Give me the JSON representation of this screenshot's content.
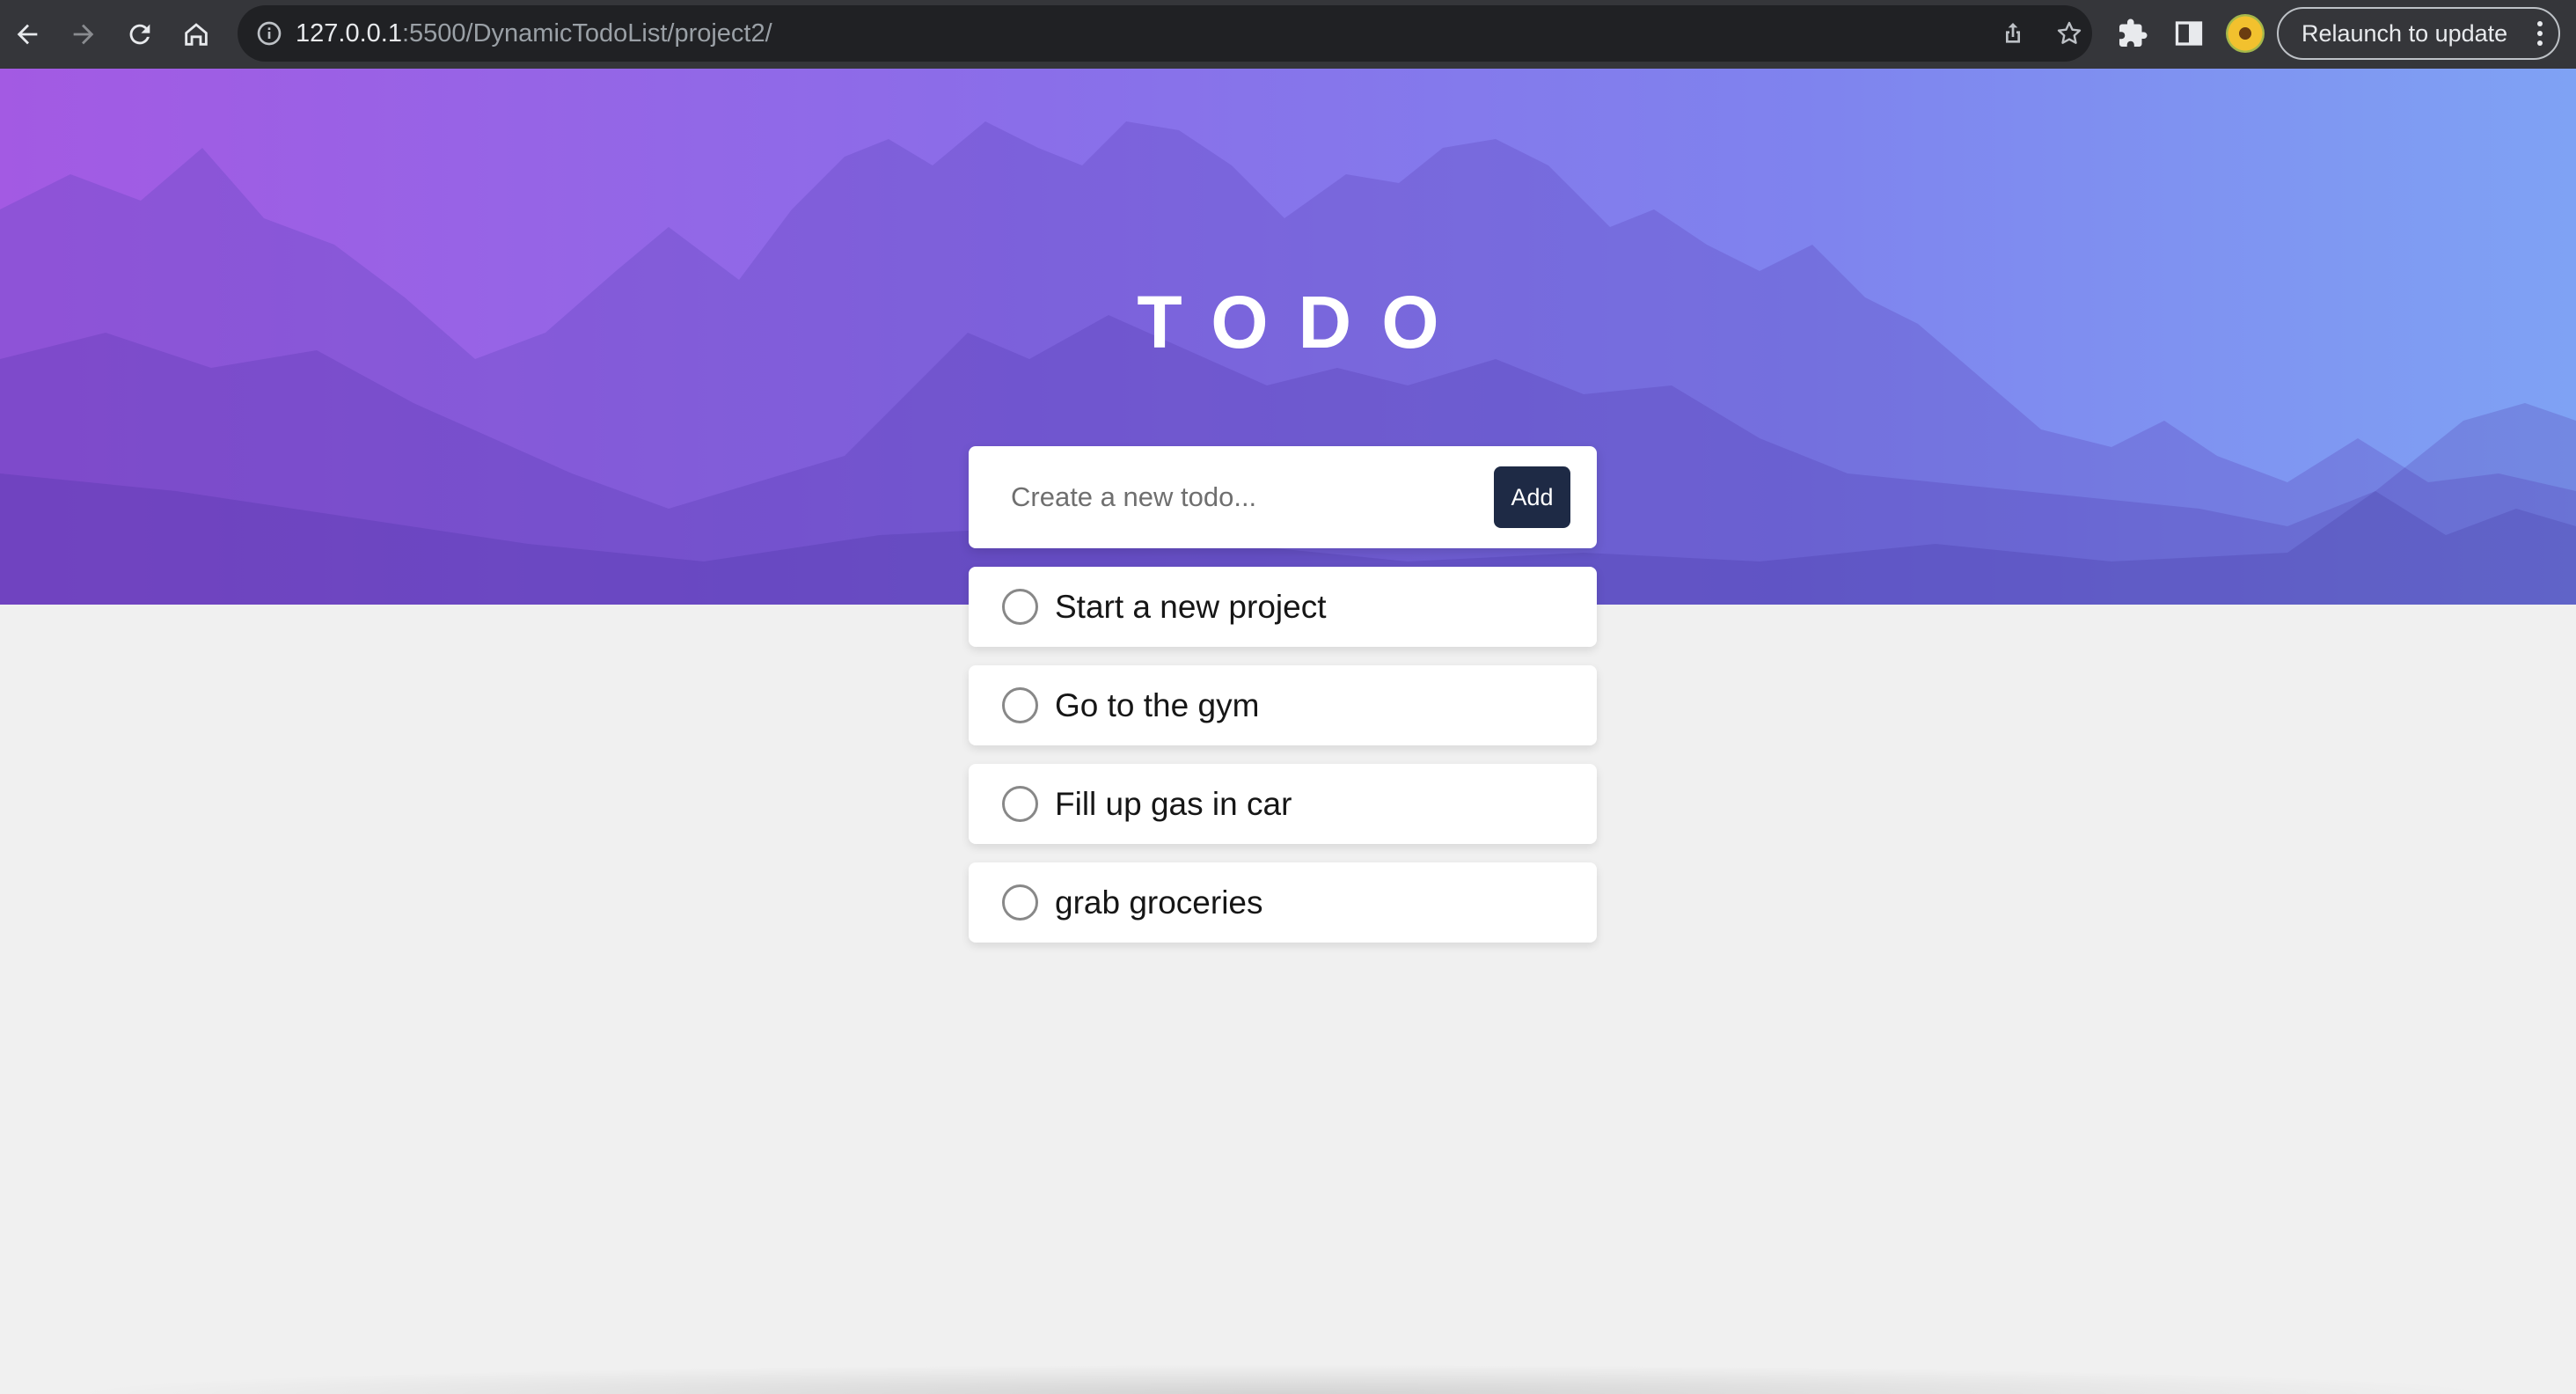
{
  "browser": {
    "url_host": "127.0.0.1",
    "url_path": ":5500/DynamicTodoList/project2/",
    "relaunch_label": "Relaunch to update",
    "icons": [
      "back-icon",
      "forward-icon",
      "reload-icon",
      "home-icon",
      "info-icon",
      "share-icon",
      "star-icon",
      "extensions-icon",
      "side-panel-icon",
      "avatar",
      "more-icon"
    ]
  },
  "app": {
    "title": "TODO",
    "input_placeholder": "Create a new todo...",
    "add_label": "Add",
    "accent": "#1e2a45",
    "todos": [
      {
        "text": "Start a new project",
        "done": false
      },
      {
        "text": "Go to the gym",
        "done": false
      },
      {
        "text": "Fill up gas in car",
        "done": false
      },
      {
        "text": "grab groceries",
        "done": false
      }
    ]
  }
}
